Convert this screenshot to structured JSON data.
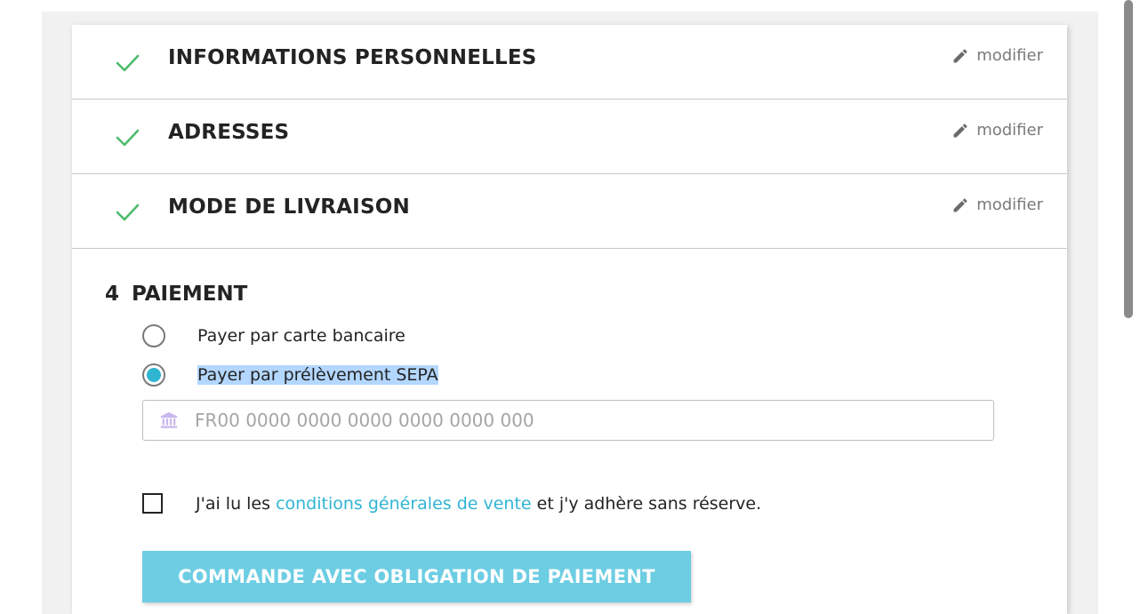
{
  "steps": [
    {
      "title": "INFORMATIONS PERSONNELLES",
      "edit_label": "modifier",
      "completed": true
    },
    {
      "title": "ADRESSES",
      "edit_label": "modifier",
      "completed": true
    },
    {
      "title": "MODE DE LIVRAISON",
      "edit_label": "modifier",
      "completed": true
    }
  ],
  "payment": {
    "number": "4",
    "title": "PAIEMENT",
    "options": [
      {
        "label": "Payer par carte bancaire",
        "selected": false
      },
      {
        "label": "Payer par prélèvement SEPA",
        "selected": true
      }
    ],
    "iban_placeholder": "FR00 0000 0000 0000 0000 0000 000",
    "iban_value": "",
    "terms_prefix": "J'ai lu les ",
    "terms_link": "conditions générales de vente",
    "terms_suffix": " et j'y adhère sans réserve.",
    "terms_checked": false,
    "submit_label": "COMMANDE AVEC OBLIGATION DE PAIEMENT"
  },
  "icons": {
    "check": "check-icon",
    "edit": "pencil-icon",
    "bank": "bank-icon"
  },
  "colors": {
    "accent": "#2fb5d2",
    "check": "#4cbb6c",
    "button": "#6ccde3",
    "selection": "#b3d7ff"
  }
}
